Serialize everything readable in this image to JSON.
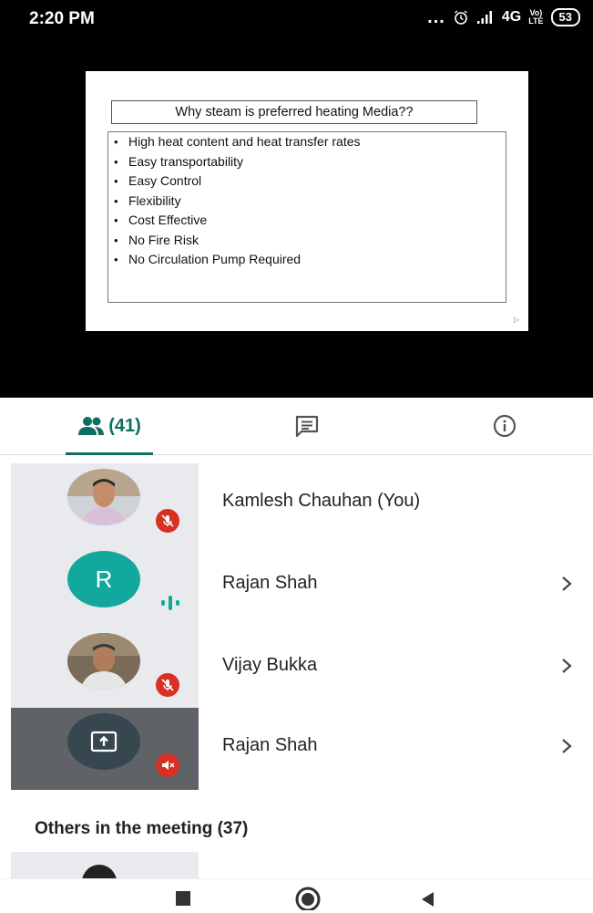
{
  "status_bar": {
    "time": "2:20 PM",
    "dots": "...",
    "network": "4G",
    "volte": "Vo)\nLTE",
    "battery": "53",
    "icons": [
      "alarm-icon",
      "signal-icon"
    ]
  },
  "slide": {
    "title": "Why steam is preferred heating Media??",
    "bullets": [
      "High heat content and heat transfer rates",
      "Easy transportability",
      "Easy Control",
      "Flexibility",
      "Cost Effective",
      "No Fire Risk",
      "No Circulation Pump Required"
    ]
  },
  "tabs": {
    "people_count": "(41)",
    "icons": [
      "people-icon",
      "chat-icon",
      "info-icon"
    ],
    "accent": "#0e6e61"
  },
  "participants": [
    {
      "name": "Kamlesh Chauhan (You)",
      "mic": "muted",
      "has_chevron": false
    },
    {
      "name": "Rajan Shah",
      "avatar_letter": "R",
      "mic": "speaking",
      "has_chevron": true
    },
    {
      "name": "Vijay Bukka",
      "mic": "muted",
      "has_chevron": true
    },
    {
      "name": "Rajan Shah",
      "mic": "muted",
      "presenting": true,
      "has_chevron": true
    }
  ],
  "others_heading": "Others in the meeting (37)",
  "colors": {
    "muted_red": "#d93025",
    "teal": "#13a89e",
    "avatar_column": "#e8eaed"
  },
  "navbar": {
    "icons": [
      "recents-square-icon",
      "home-circle-icon",
      "back-triangle-icon"
    ]
  }
}
